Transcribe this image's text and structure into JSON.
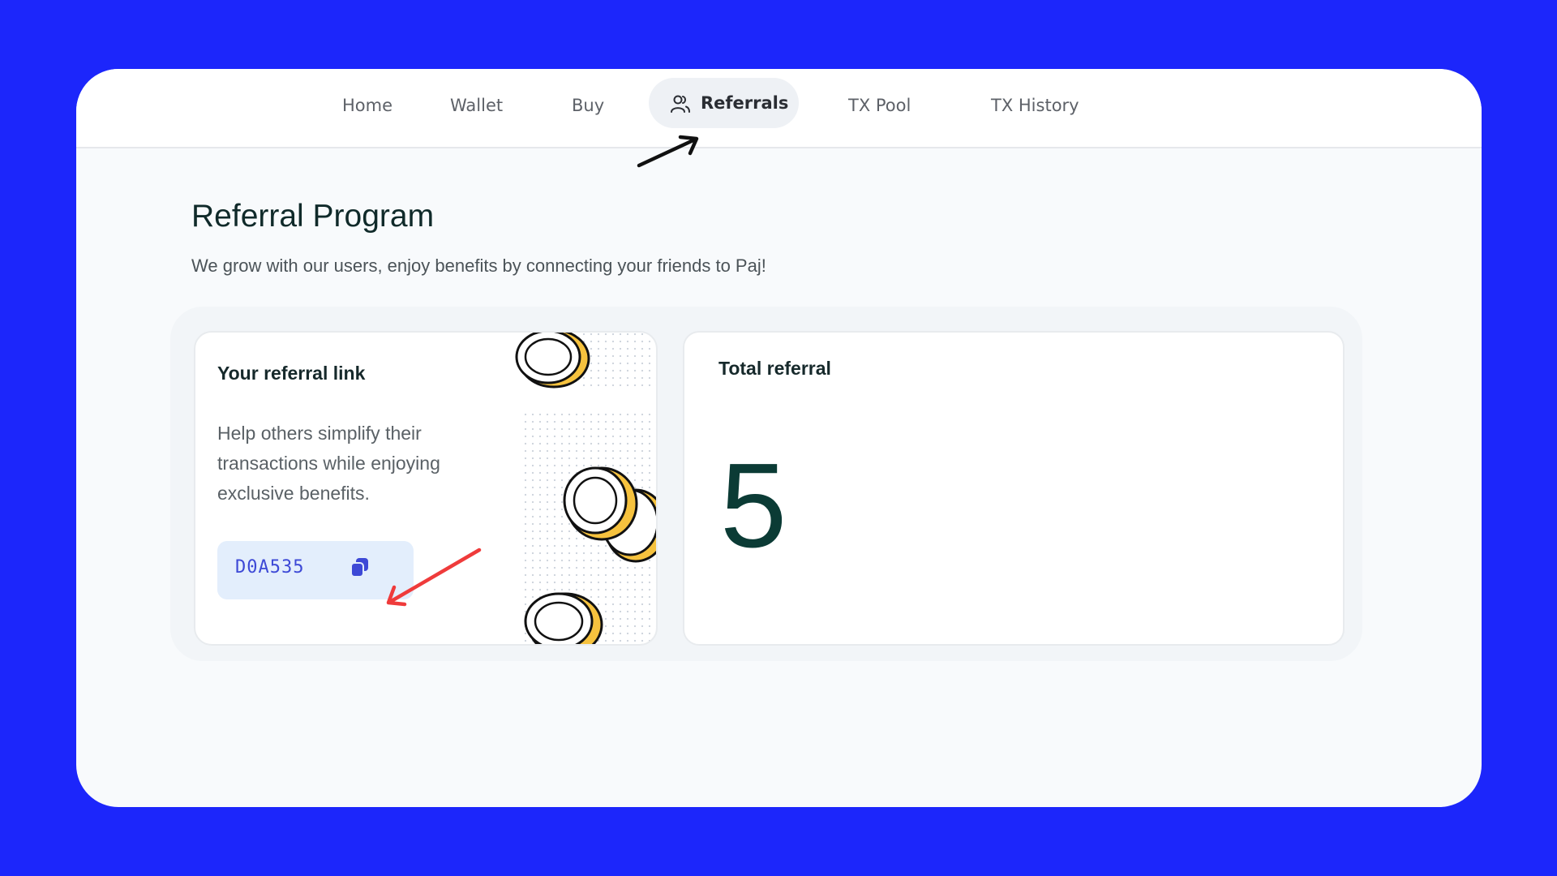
{
  "nav": {
    "items": [
      {
        "label": "Home"
      },
      {
        "label": "Wallet"
      },
      {
        "label": "Buy"
      },
      {
        "label": "Referrals",
        "active": true,
        "icon": "users-icon"
      },
      {
        "label": "TX Pool"
      },
      {
        "label": "TX History"
      }
    ]
  },
  "page": {
    "title": "Referral Program",
    "subtitle": "We grow with our users, enjoy benefits by connecting your friends to Paj!"
  },
  "referral_card": {
    "title": "Your referral link",
    "description": "Help others simplify their transactions while enjoying exclusive benefits.",
    "code": "D0A535",
    "copy_icon": "copy-icon"
  },
  "total_card": {
    "title": "Total referral",
    "value": "5"
  },
  "colors": {
    "background": "#1c26fb",
    "accent": "#3d49d6",
    "total_value": "#0b3b35",
    "annotation_arrow": "#ef3b3b"
  }
}
